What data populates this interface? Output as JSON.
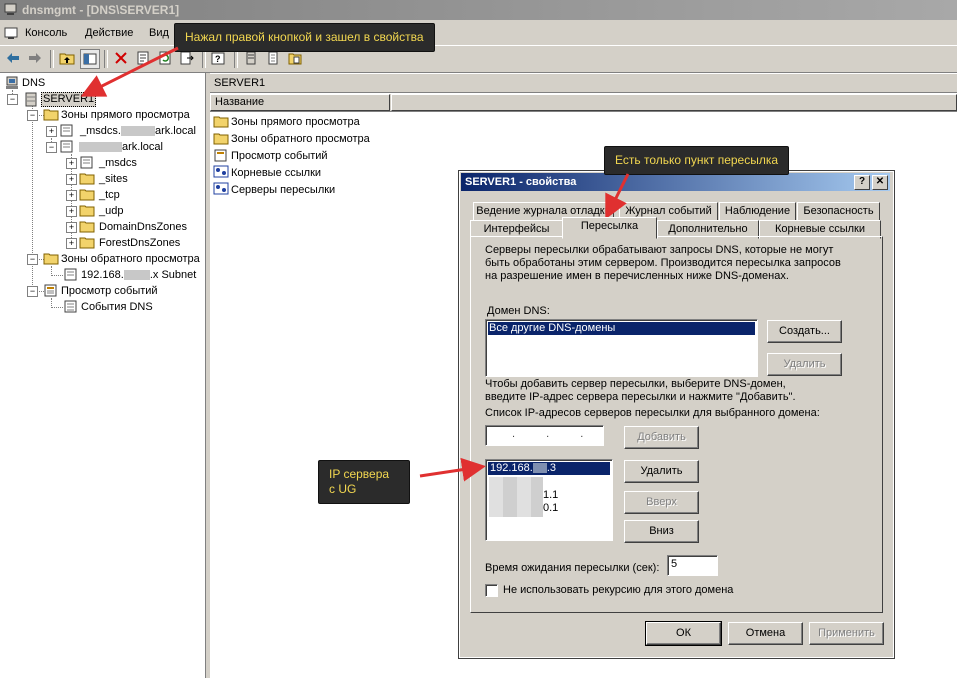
{
  "window": {
    "title": "dnsmgmt - [DNS\\SERVER1]"
  },
  "menu": {
    "items": [
      "Консоль",
      "Действие",
      "Вид"
    ]
  },
  "callouts": {
    "top": "Нажал правой кнопкой и зашел в свойства",
    "tabs": "Есть только пункт пересылка",
    "ip": "IP сервера\nс UG"
  },
  "tree": {
    "root": "DNS",
    "server": "SERVER1",
    "forward_zones": "Зоны прямого просмотра",
    "msdcs_zone_prefix": "_msdcs.",
    "msdcs_zone_suffix": "ark.local",
    "main_zone_suffix": "ark.local",
    "children": [
      "_msdcs",
      "_sites",
      "_tcp",
      "_udp",
      "DomainDnsZones",
      "ForestDnsZones"
    ],
    "reverse_zones": "Зоны обратного просмотра",
    "subnet_prefix": "192.168.",
    "subnet_suffix": ".x Subnet",
    "event_viewer": "Просмотр событий",
    "dns_events": "События DNS"
  },
  "right_pane": {
    "header": "SERVER1",
    "column": "Название",
    "items": [
      "Зоны прямого просмотра",
      "Зоны обратного просмотра",
      "Просмотр событий",
      "Корневые ссылки",
      "Серверы пересылки"
    ]
  },
  "dialog": {
    "title": "SERVER1 - свойства",
    "help_btn": "?",
    "close_btn": "✕",
    "tabs_row1": [
      "Ведение журнала отладки",
      "Журнал событий",
      "Наблюдение",
      "Безопасность"
    ],
    "tabs_row2": [
      "Интерфейсы",
      "Пересылка",
      "Дополнительно",
      "Корневые ссылки"
    ],
    "description": "Серверы пересылки обрабатывают запросы DNS, которые не могут быть обработаны этим сервером. Производится пересылка запросов на разрешение имен в перечисленных ниже DNS-доменах.",
    "domain_label": "Домен DNS:",
    "domain_items": [
      "Все другие DNS-домены"
    ],
    "create_btn": "Создать...",
    "delete_btn": "Удалить",
    "hint": "Чтобы добавить сервер пересылки, выберите DNS-домен, введите IP-адрес сервера пересылки и нажмите \"Добавить\".",
    "ip_list_label": "Список IP-адресов серверов пересылки для выбранного домена:",
    "ip_input_value": ". . .",
    "add_btn": "Добавить",
    "ip_selected_prefix": "192.168.",
    "ip_selected_suffix": ".3",
    "ip_other_1": "1.1",
    "ip_other_2": "0.1",
    "remove_btn": "Удалить",
    "up_btn": "Вверх",
    "down_btn": "Вниз",
    "timeout_label": "Время ожидания пересылки (сек):",
    "timeout_value": "5",
    "no_recursion_label": "Не использовать рекурсию для этого домена",
    "no_recursion_checked": false,
    "ok_btn": "ОК",
    "cancel_btn": "Отмена",
    "apply_btn": "Применить"
  }
}
